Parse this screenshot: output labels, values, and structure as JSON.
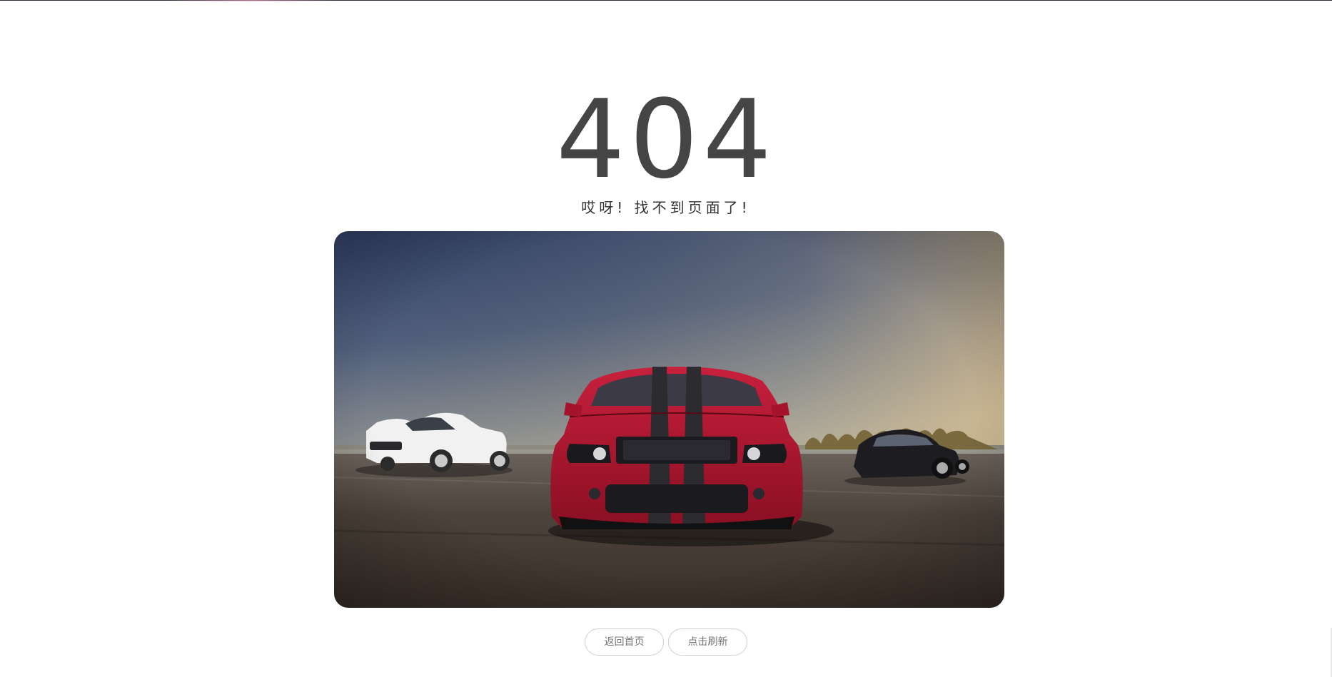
{
  "error": {
    "code": "404",
    "message": "哎呀! 找不到页面了!"
  },
  "hero_image": {
    "description_icon": "cars-photo",
    "colors": {
      "sky_top": "#3a4a6a",
      "sky_horizon": "#b7ad98",
      "road": "#4a4038",
      "red_car": "#a5122b",
      "stripe": "#2b2b30",
      "white_car": "#f2f2f2",
      "black_car": "#1b1b1f"
    }
  },
  "actions": {
    "home_label": "返回首页",
    "refresh_label": "点击刷新"
  }
}
